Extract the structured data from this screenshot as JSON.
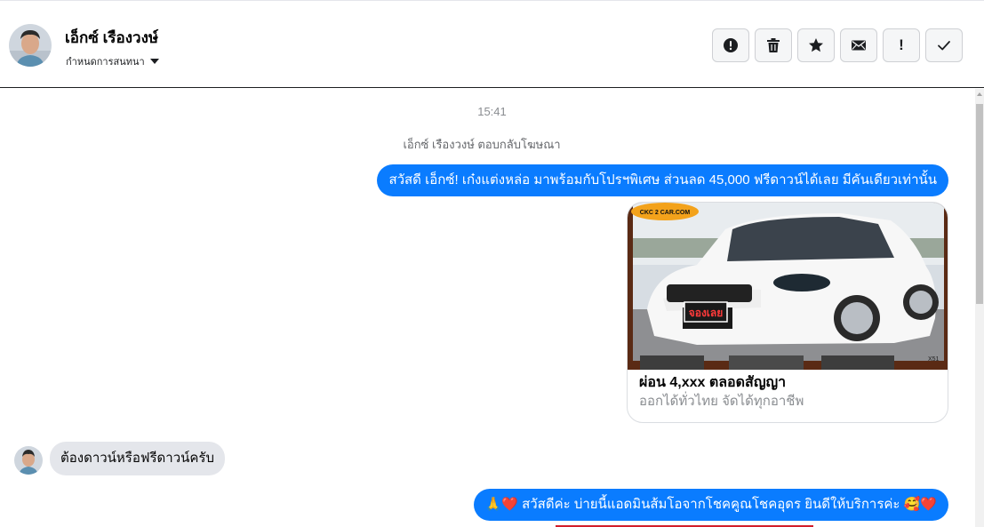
{
  "header": {
    "contact_name": "เอ็กซ์ เรืองวงษ์",
    "assign_label": "กำหนดการสนทนา",
    "actions": [
      {
        "name": "mark-spam",
        "icon": "exclamation-circle-icon"
      },
      {
        "name": "delete",
        "icon": "trash-icon"
      },
      {
        "name": "star",
        "icon": "star-icon"
      },
      {
        "name": "mark-unread",
        "icon": "envelope-icon"
      },
      {
        "name": "follow-up",
        "icon": "exclamation-icon",
        "glyph": "!"
      },
      {
        "name": "mark-done",
        "icon": "check-icon"
      }
    ]
  },
  "thread": {
    "timestamp": "15:41",
    "reply_note": "เอ็กซ์ เรืองวงษ์ ตอบกลับโฆษณา",
    "messages": [
      {
        "direction": "outgoing",
        "text": "สวัสดี เอ็กซ์! เก๋งแต่งหล่อ มาพร้อมกับโปรฯพิเศษ ส่วนลด 45,000 ฟรีดาวน์ได้เลย มีคันเดียวเท่านั้น"
      },
      {
        "direction": "outgoing",
        "type": "ad_card",
        "image": {
          "badge": "CKC 2 CAR.COM",
          "plate": "จองเลย",
          "corner": "X51"
        },
        "title": "ผ่อน 4,xxx ตลอดสัญญา",
        "subtitle": "ออกได้ทั่วไทย จัดได้ทุกอาชีพ"
      },
      {
        "direction": "incoming",
        "text": "ต้องดาวน์หรือฟรีดาวน์ครับ"
      },
      {
        "direction": "outgoing",
        "text": "🙏❤️ สวัสดีค่ะ บ่ายนี้แอดมินส้มโอจากโชคคูณโชคอุดร ยินดีให้บริการค่ะ 🥰❤️"
      }
    ]
  },
  "colors": {
    "outgoing_bubble": "#0a7cff",
    "incoming_bubble": "#e4e6eb",
    "muted_text": "#8a8d91"
  }
}
